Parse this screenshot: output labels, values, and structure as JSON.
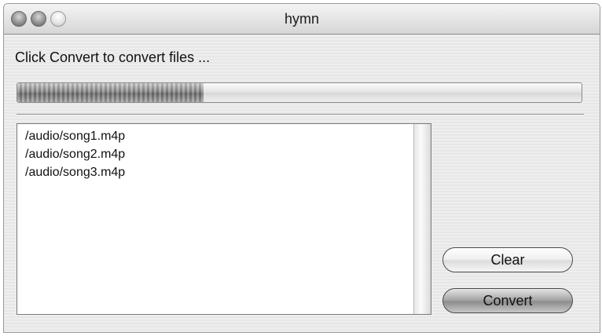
{
  "window": {
    "title": "hymn",
    "controls": [
      "close",
      "minimize",
      "zoom"
    ]
  },
  "status": {
    "message": "Click Convert to convert files ..."
  },
  "progress": {
    "fraction": 0.33
  },
  "file_list": {
    "items": [
      "/audio/song1.m4p",
      "/audio/song2.m4p",
      "/audio/song3.m4p"
    ]
  },
  "buttons": {
    "clear_label": "Clear",
    "convert_label": "Convert"
  }
}
